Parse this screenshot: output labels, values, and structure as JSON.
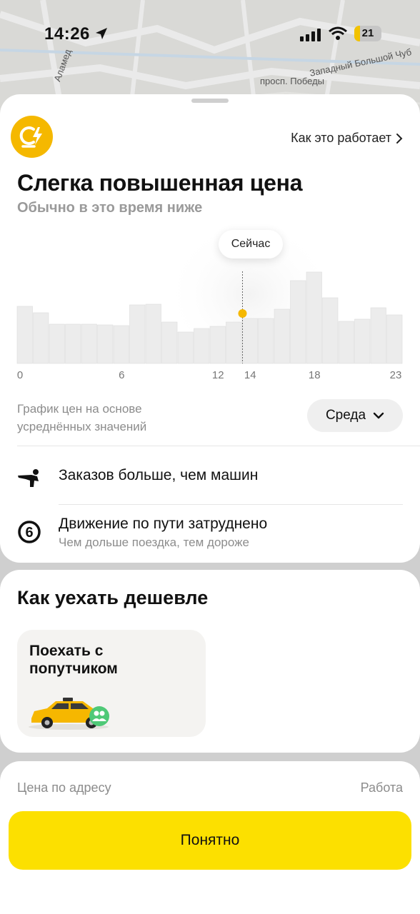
{
  "status_bar": {
    "time": "14:26",
    "battery": "21"
  },
  "map": {
    "labels": [
      "Западный Большой Чуб",
      "просп. Победы",
      "Аламед"
    ]
  },
  "surge": {
    "how_link": "Как это работает",
    "title": "Слегка повышенная цена",
    "subtitle": "Обычно в это время ниже",
    "now_label": "Сейчас",
    "chart_note": "График цен на основе усреднённых значений",
    "day": "Среда",
    "reasons": [
      {
        "text": "Заказов больше, чем машин",
        "sub": ""
      },
      {
        "text": "Движение по пути затруднено",
        "sub": "Чем дольше поездка, тем дороже"
      }
    ]
  },
  "chart_data": {
    "type": "bar",
    "x": [
      0,
      1,
      2,
      3,
      4,
      5,
      6,
      7,
      8,
      9,
      10,
      11,
      12,
      13,
      14,
      15,
      16,
      17,
      18,
      19,
      20,
      21,
      22,
      23
    ],
    "values": [
      80,
      71,
      55,
      55,
      55,
      54,
      53,
      82,
      83,
      58,
      44,
      49,
      52,
      58,
      63,
      63,
      76,
      116,
      128,
      92,
      59,
      62,
      78,
      68
    ],
    "tick_labels": [
      "0",
      "6",
      "12",
      "14",
      "18",
      "23"
    ],
    "tick_positions": [
      0,
      6,
      12,
      14,
      18,
      23
    ],
    "current_hour": 14,
    "current_value": 70,
    "ylim": [
      0,
      140
    ],
    "colors": {
      "bar": "#ececec",
      "bar_stroke": "#dcdcdc",
      "marker": "#f5b800"
    }
  },
  "cheaper": {
    "title": "Как уехать дешевле",
    "option_label": "Поехать с попутчиком"
  },
  "footer": {
    "address_label": "Цена по адресу",
    "destination": "Работа",
    "ok_button": "Понятно"
  }
}
